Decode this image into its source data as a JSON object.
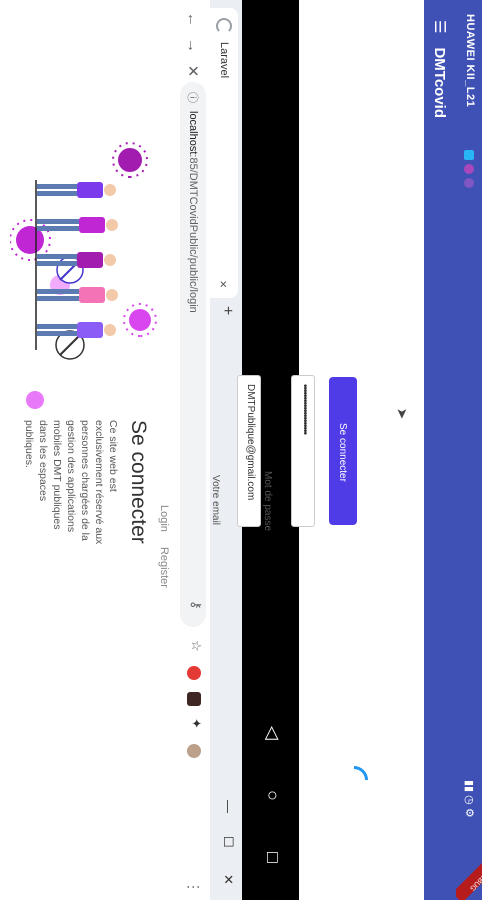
{
  "browser": {
    "tab_title": "Laravel",
    "tab_close": "×",
    "new_tab": "+",
    "url_host": "localhost",
    "url_rest": ":85/DMTCovidPublic/public/login",
    "window_min": "—",
    "window_max": "☐",
    "window_close": "✕"
  },
  "page": {
    "nav_login": "Login",
    "nav_register": "Register",
    "heading": "Se connecter",
    "description": "Ce site web est exclusivement réservé aux personnes chargées de la gestion des applications mobiles DMT publiques dans les espaces publiques.",
    "email_label": "Votre email",
    "email_value": "DMTPublique@gmail.com",
    "password_label": "Mot de passe",
    "password_value": "••••••••••••••••••••",
    "submit_label": "Se connecter"
  },
  "android": {
    "device_name": "HUAWEI KII_L21",
    "app_title": "DMTcovid",
    "debug_badge": "DEBUG"
  },
  "colors": {
    "android_primary": "#3f51b5",
    "submit_button": "#4f3ce6"
  }
}
